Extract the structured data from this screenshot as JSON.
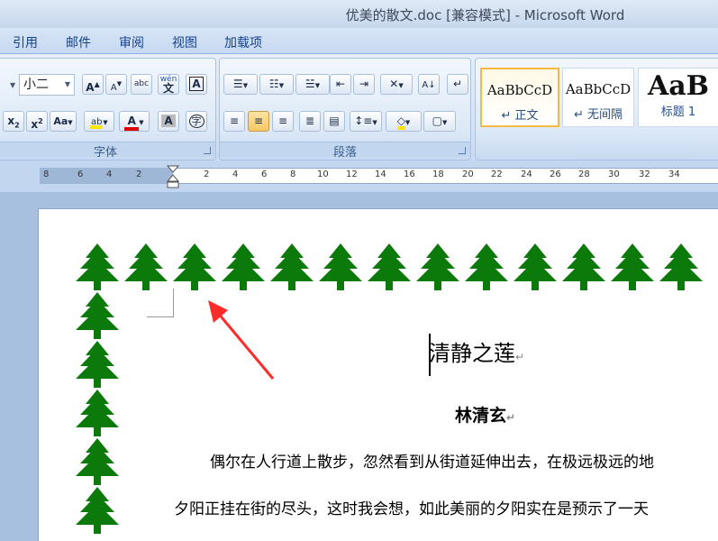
{
  "window": {
    "title": "优美的散文.doc [兼容模式] - Microsoft Word"
  },
  "tabs": [
    "引用",
    "邮件",
    "审阅",
    "视图",
    "加载项"
  ],
  "font_group": {
    "label": "字体",
    "size_value": "小二",
    "buttons": {
      "grow": "A",
      "shrink": "A",
      "clear": "abc",
      "phonetic": "wén",
      "border": "A",
      "subscript": "x",
      "superscript": "x",
      "case": "Aa",
      "font_color": "A",
      "shading": "A",
      "enclose": "字"
    }
  },
  "paragraph_group": {
    "label": "段落"
  },
  "styles": [
    {
      "preview": "AaBbCcD",
      "name": "正文",
      "selected": true
    },
    {
      "preview": "AaBbCcD",
      "name": "无间隔",
      "selected": false
    },
    {
      "preview": "AaB",
      "name": "标题 1",
      "selected": false
    }
  ],
  "ruler_ticks": [
    "8",
    "6",
    "4",
    "2",
    "2",
    "4",
    "6",
    "8",
    "10",
    "12",
    "14",
    "16",
    "18",
    "20",
    "22",
    "24",
    "26",
    "28",
    "30",
    "32",
    "34"
  ],
  "document": {
    "title": "清静之莲",
    "author": "林清玄",
    "paragraph_mark": "↵",
    "para1": "偶尔在人行道上散步，忽然看到从街道延伸出去，在极远极远的地",
    "para2": "夕阳正挂在街的尽头，这时我会想，如此美丽的夕阳实在是预示了一天"
  },
  "colors": {
    "tree": "#0b7a0b",
    "arrow": "#ff2b2b"
  }
}
